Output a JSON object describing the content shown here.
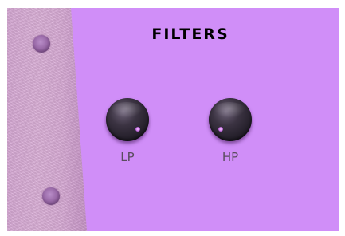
{
  "panel": {
    "title": "FILTERS",
    "background_color": "#d08ef8"
  },
  "knobs": [
    {
      "label": "LP",
      "icon": "knob-icon"
    },
    {
      "label": "HP",
      "icon": "knob-icon"
    }
  ],
  "rail": {
    "screws": [
      "screw-icon",
      "screw-icon"
    ]
  }
}
